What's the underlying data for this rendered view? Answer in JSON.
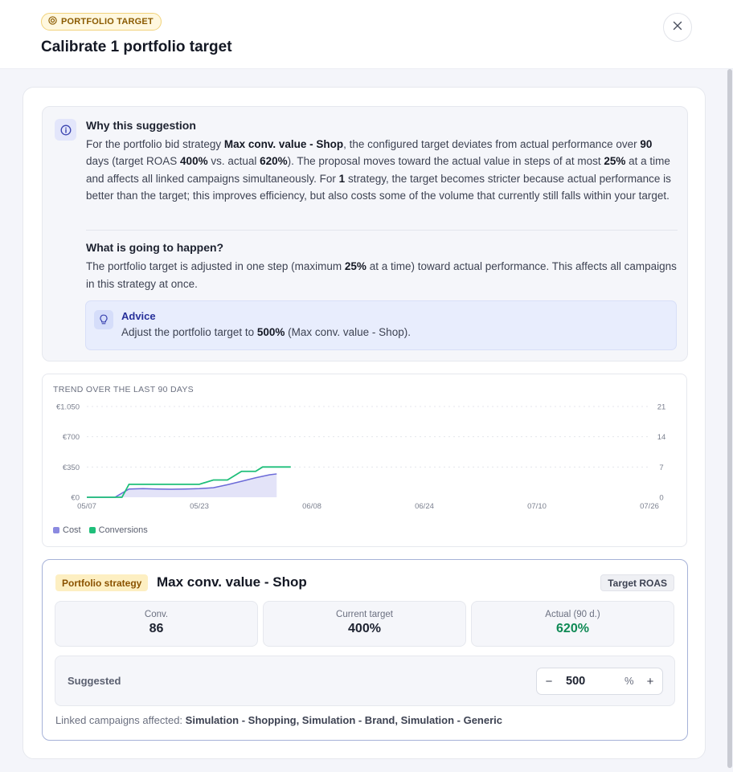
{
  "header": {
    "badge": "PORTFOLIO TARGET",
    "title": "Calibrate 1 portfolio target",
    "close_icon": "close-icon"
  },
  "why": {
    "title": "Why this suggestion",
    "p1": "For the portfolio bid strategy ",
    "strategy": "Max conv. value - Shop",
    "p2": ", the configured target deviates from actual performance over ",
    "days": "90",
    "p3": " days (target ROAS ",
    "target": "400%",
    "p4": " vs. actual ",
    "actual": "620%",
    "p5": "). The proposal moves toward the actual value in steps of at most ",
    "step": "25%",
    "p6": " at a time and affects all linked campaigns simultaneously. For ",
    "count": "1",
    "p7": " strategy, the target becomes stricter because actual performance is better than the target; this improves efficiency, but also costs some of the volume that currently still falls within your target."
  },
  "happen": {
    "title": "What is going to happen?",
    "p1": "The portfolio target is adjusted in one step (maximum ",
    "step": "25%",
    "p2": " at a time) toward actual performance. This affects all campaigns in this strategy at once."
  },
  "advice": {
    "title": "Advice",
    "p1": "Adjust the portfolio target to ",
    "value": "500%",
    "p2": " (Max conv. value - Shop)."
  },
  "chart_data": {
    "type": "line",
    "title": "TREND OVER THE LAST 90 DAYS",
    "x_ticks": [
      "05/07",
      "05/23",
      "06/08",
      "06/24",
      "07/10",
      "07/26"
    ],
    "y_left_ticks": [
      "€0",
      "€350",
      "€700",
      "€1.050"
    ],
    "y_right_ticks": [
      "0",
      "7",
      "14",
      "21"
    ],
    "y_left_range": [
      0,
      1050
    ],
    "y_right_range": [
      0,
      21
    ],
    "grid": true,
    "legend_position": "bottom-left",
    "series": [
      {
        "name": "Cost",
        "axis": "left",
        "style": "area",
        "color": "#6b6ad8",
        "points": [
          [
            "05/07",
            0
          ],
          [
            "05/09",
            0
          ],
          [
            "05/11",
            0
          ],
          [
            "05/13",
            95
          ],
          [
            "05/15",
            100
          ],
          [
            "05/17",
            95
          ],
          [
            "05/19",
            93
          ],
          [
            "05/21",
            95
          ],
          [
            "05/23",
            100
          ],
          [
            "05/25",
            110
          ],
          [
            "05/27",
            145
          ],
          [
            "05/29",
            185
          ],
          [
            "05/31",
            225
          ],
          [
            "06/02",
            260
          ],
          [
            "06/03",
            270
          ]
        ]
      },
      {
        "name": "Conversions",
        "axis": "right",
        "style": "line",
        "color": "#1fbf7a",
        "points": [
          [
            "05/07",
            0
          ],
          [
            "05/10",
            0
          ],
          [
            "05/12",
            0
          ],
          [
            "05/13",
            3
          ],
          [
            "05/17",
            3
          ],
          [
            "05/21",
            3
          ],
          [
            "05/23",
            3
          ],
          [
            "05/25",
            4
          ],
          [
            "05/27",
            4
          ],
          [
            "05/28",
            5
          ],
          [
            "05/29",
            6
          ],
          [
            "05/31",
            6
          ],
          [
            "06/01",
            7
          ],
          [
            "06/05",
            7
          ]
        ]
      }
    ]
  },
  "strategy": {
    "badge": "Portfolio strategy",
    "title": "Max conv. value - Shop",
    "type_badge": "Target ROAS",
    "metrics": [
      {
        "label": "Conv.",
        "value": "86"
      },
      {
        "label": "Current target",
        "value": "400%"
      },
      {
        "label": "Actual (90 d.)",
        "value": "620%"
      }
    ],
    "suggested_label": "Suggested",
    "stepper": {
      "minus": "−",
      "value": "500",
      "unit": "%",
      "plus": "+"
    },
    "linked_label": "Linked campaigns affected: ",
    "linked_value": "Simulation - Shopping, Simulation - Brand, Simulation - Generic"
  },
  "colors": {
    "accent": "#27309a",
    "positive": "#0f8a55",
    "warning_bg": "#fdefc2"
  }
}
